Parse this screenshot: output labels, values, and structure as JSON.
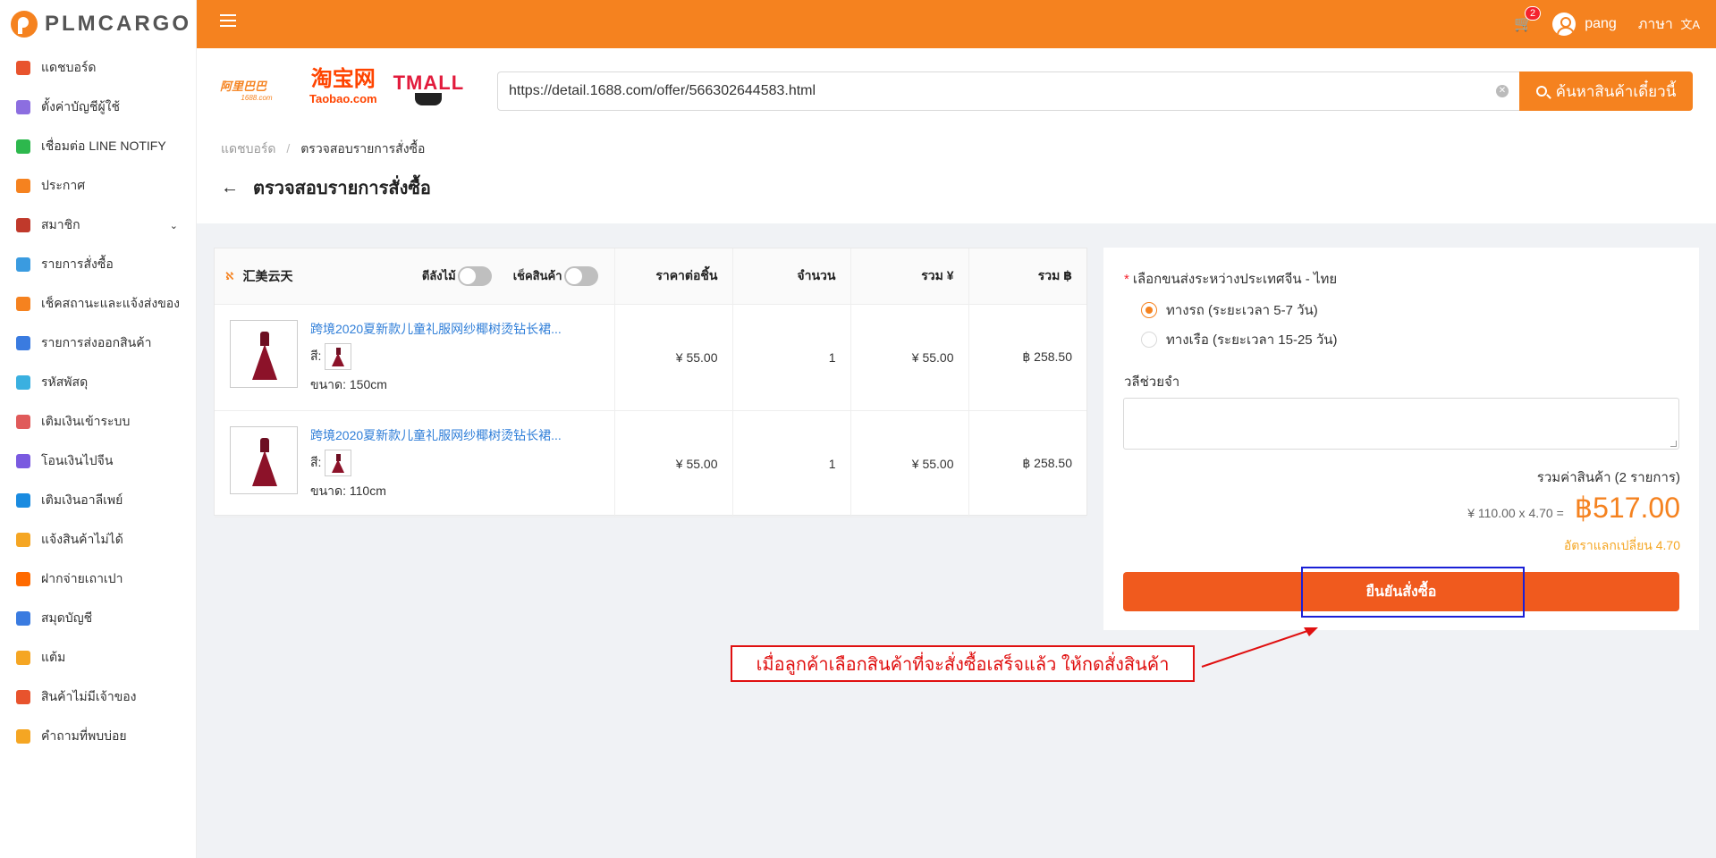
{
  "app": {
    "logo_text": "PLMCARGO"
  },
  "sidebar": {
    "items": [
      {
        "label": "แดชบอร์ด",
        "icon": "chart-icon",
        "color": "#e8532d"
      },
      {
        "label": "ตั้งค่าบัญชีผู้ใช้",
        "icon": "user-settings-icon",
        "color": "#8c6ee0"
      },
      {
        "label": "เชื่อมต่อ LINE NOTIFY",
        "icon": "line-icon",
        "color": "#2db84d"
      },
      {
        "label": "ประกาศ",
        "icon": "megaphone-icon",
        "color": "#f5821f"
      },
      {
        "label": "สมาชิก",
        "icon": "member-icon",
        "color": "#c0392b"
      },
      {
        "label": "รายการสั่งซื้อ",
        "icon": "cart-icon",
        "color": "#3a9be0"
      },
      {
        "label": "เช็คสถานะและแจ้งส่งของ",
        "icon": "truck-icon",
        "color": "#f5821f"
      },
      {
        "label": "รายการส่งออกสินค้า",
        "icon": "export-icon",
        "color": "#3a7be0"
      },
      {
        "label": "รหัสพัสดุ",
        "icon": "box-icon",
        "color": "#3ab0e0"
      },
      {
        "label": "เติมเงินเข้าระบบ",
        "icon": "piggy-bank-icon",
        "color": "#e05a5a"
      },
      {
        "label": "โอนเงินไปจีน",
        "icon": "yuan-icon",
        "color": "#7a5ae0"
      },
      {
        "label": "เติมเงินอาลีเพย์",
        "icon": "alipay-icon",
        "color": "#1a8be0"
      },
      {
        "label": "แจ้งสินค้าไม่ได้",
        "icon": "no-product-icon",
        "color": "#f5a623"
      },
      {
        "label": "ฝากจ่ายเถาเปา",
        "icon": "taobao-icon",
        "color": "#ff6a00"
      },
      {
        "label": "สมุดบัญชี",
        "icon": "wallet-icon",
        "color": "#3a7be0"
      },
      {
        "label": "แต้ม",
        "icon": "medal-icon",
        "color": "#f5a623"
      },
      {
        "label": "สินค้าไม่มีเจ้าของ",
        "icon": "search-box-icon",
        "color": "#e8532d"
      },
      {
        "label": "คำถามที่พบบ่อย",
        "icon": "question-icon",
        "color": "#f5a623"
      }
    ]
  },
  "topbar": {
    "cart_count": "2",
    "username": "pang",
    "language_label": "ภาษา",
    "language_icon": "文A"
  },
  "brands": {
    "alibaba": "阿里巴巴",
    "alibaba_sub": "1688.com",
    "taobao": "淘宝网",
    "taobao_sub": "Taobao.com",
    "tmall": "TMALL"
  },
  "search": {
    "url_value": "https://detail.1688.com/offer/566302644583.html",
    "button_label": "ค้นหาสินค้าเดี๋ยวนี้"
  },
  "breadcrumb": {
    "home": "แดชบอร์ด",
    "separator": "/",
    "current": "ตรวจสอบรายการสั่งซื้อ"
  },
  "page_title": "ตรวจสอบรายการสั่งซื้อ",
  "order_table": {
    "shop_name": "汇美云天",
    "toggle_wood_label": "ตีลังไม้",
    "toggle_check_label": "เช็คสินค้า",
    "headers": {
      "unit_price": "ราคาต่อชิ้น",
      "quantity": "จำนวน",
      "total_cny": "รวม ¥",
      "total_thb": "รวม ฿"
    },
    "rows": [
      {
        "title": "跨境2020夏新款儿童礼服网纱椰树烫钻长裙...",
        "color_label": "สี:",
        "size": "ขนาด: 150cm",
        "unit_price": "¥ 55.00",
        "quantity": "1",
        "total_cny": "¥ 55.00",
        "total_thb": "฿ 258.50"
      },
      {
        "title": "跨境2020夏新款儿童礼服网纱椰树烫钻长裙...",
        "color_label": "สี:",
        "size": "ขนาด: 110cm",
        "unit_price": "¥ 55.00",
        "quantity": "1",
        "total_cny": "¥ 55.00",
        "total_thb": "฿ 258.50"
      }
    ]
  },
  "checkout": {
    "required_mark": "*",
    "shipping_label": "เลือกขนส่งระหว่างประเทศจีน - ไทย",
    "shipping_options": [
      {
        "label": "ทางรถ (ระยะเวลา 5-7 วัน)",
        "selected": true
      },
      {
        "label": "ทางเรือ (ระยะเวลา 15-25 วัน)",
        "selected": false
      }
    ],
    "note_label": "วลีช่วยจำ",
    "note_value": "",
    "summary_label": "รวมค่าสินค้า (2 รายการ)",
    "summary_calc": "¥ 110.00 x 4.70 =",
    "summary_total": "฿517.00",
    "exchange_rate": "อัตราแลกเปลี่ยน 4.70",
    "confirm_label": "ยืนยันสั่งซื้อ"
  },
  "annotation": {
    "callout_text": "เมื่อลูกค้าเลือกสินค้าที่จะสั่งซื้อเสร็จแล้ว ให้กดสั่งสินค้า",
    "highlight_color": "#1a20d6",
    "callout_color": "#e01010"
  },
  "colors": {
    "brand_orange": "#f5821f",
    "confirm_orange": "#f05a1e",
    "link_blue": "#2f7ed8"
  }
}
